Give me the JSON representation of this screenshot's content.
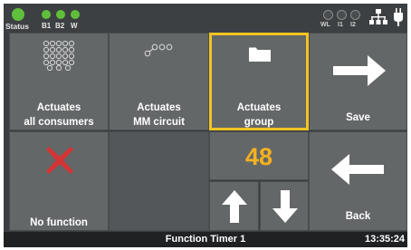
{
  "status_bar": {
    "status_label": "Status",
    "b1_label": "B1",
    "b2_label": "B2",
    "w_label": "W",
    "wl_label": "WL",
    "i1_label": "I1",
    "i2_label": "I2",
    "active_led_color": "#5fbf3a",
    "icons": [
      "network-icon",
      "plug-icon"
    ]
  },
  "tiles": {
    "all_consumers": {
      "line1": "Actuates",
      "line2": "all consumers",
      "icon": "all-consumers-grid-icon"
    },
    "mm_circuit": {
      "line1": "Actuates",
      "line2": "MM circuit",
      "icon": "mm-circuit-icon"
    },
    "group": {
      "line1": "Actuates",
      "line2": "group",
      "icon": "folder-icon",
      "selected": true
    },
    "save": {
      "label": "Save",
      "icon": "arrow-right-icon"
    },
    "no_function": {
      "label": "No function",
      "icon": "red-x-icon"
    },
    "back": {
      "label": "Back",
      "icon": "arrow-left-icon"
    }
  },
  "value_display": {
    "value": "48",
    "color": "#f5b21f"
  },
  "stepper": {
    "up_icon": "arrow-up-icon",
    "down_icon": "arrow-down-icon"
  },
  "bottom_bar": {
    "title": "Function Timer 1",
    "time": "13:35:24"
  },
  "colors": {
    "selection": "#f2c422",
    "no_function_x": "#d63333"
  }
}
